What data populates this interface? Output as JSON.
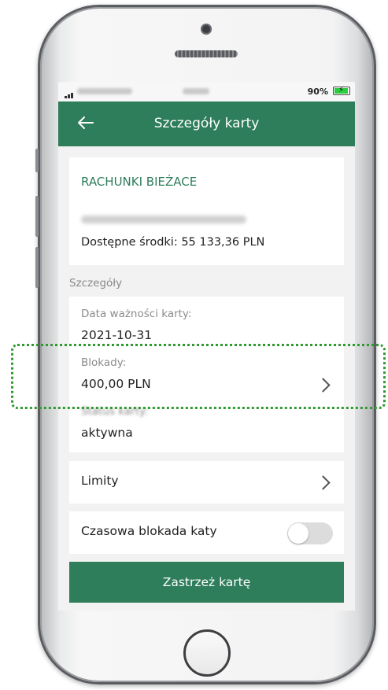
{
  "statusbar": {
    "battery_percent": "90%"
  },
  "header": {
    "title": "Szczegóły karty"
  },
  "account": {
    "title": "RACHUNKI BIEŻACE",
    "funds": "Dostępne środki: 55 133,36 PLN"
  },
  "details": {
    "section_label": "Szczegóły",
    "expiry_label": "Data ważności karty:",
    "expiry_value": "2021-10-31",
    "blocks_label": "Blokady:",
    "blocks_value": "400,00 PLN",
    "status_label": "Status karty:",
    "status_value": "aktywna"
  },
  "limits": {
    "label": "Limity"
  },
  "temp_block": {
    "label": "Czasowa blokada katy",
    "enabled": false
  },
  "actions": {
    "block_card": "Zastrzeż kartę"
  },
  "colors": {
    "brand_green": "#2e7d5b",
    "highlight_green": "#2f9a2f"
  },
  "icons": [
    "back-arrow-icon",
    "chevron-right-icon",
    "battery-icon",
    "signal-icon"
  ]
}
